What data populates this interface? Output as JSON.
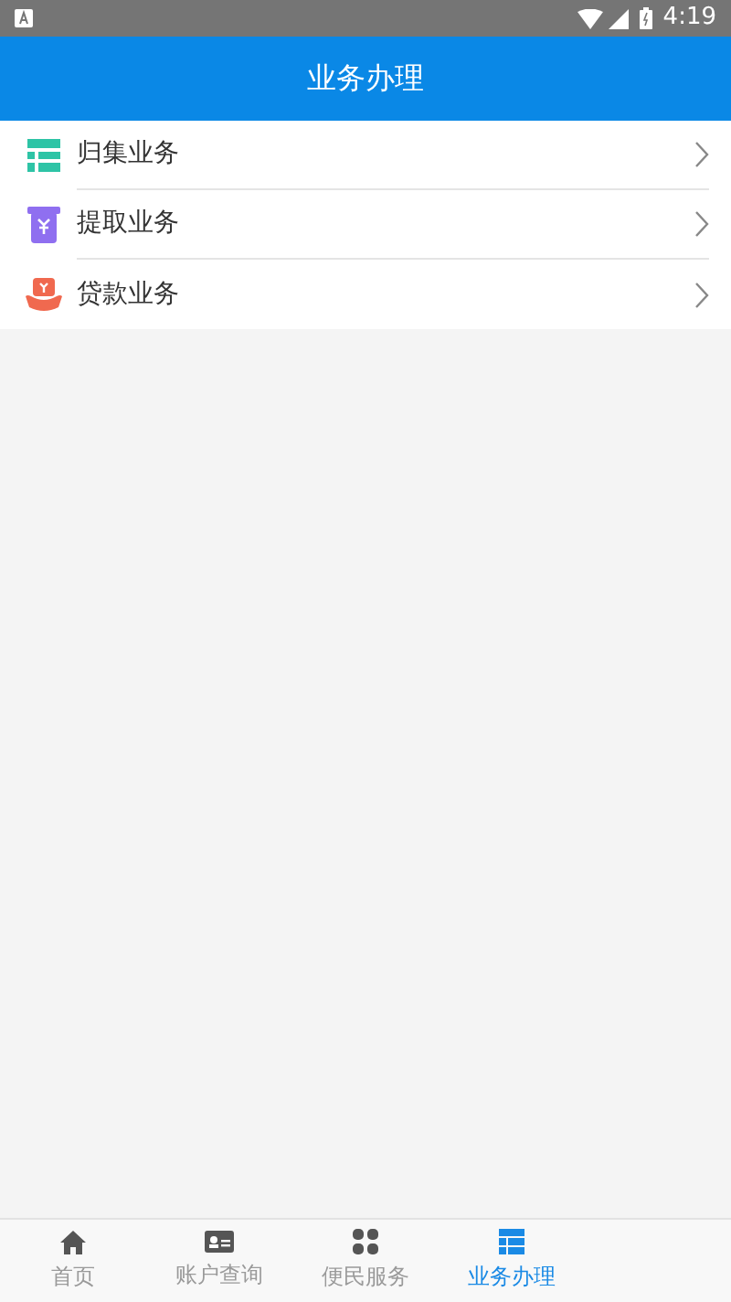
{
  "status_bar": {
    "time": "4:19"
  },
  "header": {
    "title": "业务办理"
  },
  "items": [
    {
      "kind": "collect",
      "label": "归集业务"
    },
    {
      "kind": "withdraw",
      "label": "提取业务"
    },
    {
      "kind": "loan",
      "label": "贷款业务"
    }
  ],
  "tabs": [
    {
      "kind": "home",
      "label": "首页",
      "selected": false
    },
    {
      "kind": "account",
      "label": "账户查询",
      "selected": false
    },
    {
      "kind": "services",
      "label": "便民服务",
      "selected": false
    },
    {
      "kind": "business",
      "label": "业务办理",
      "selected": true
    }
  ]
}
